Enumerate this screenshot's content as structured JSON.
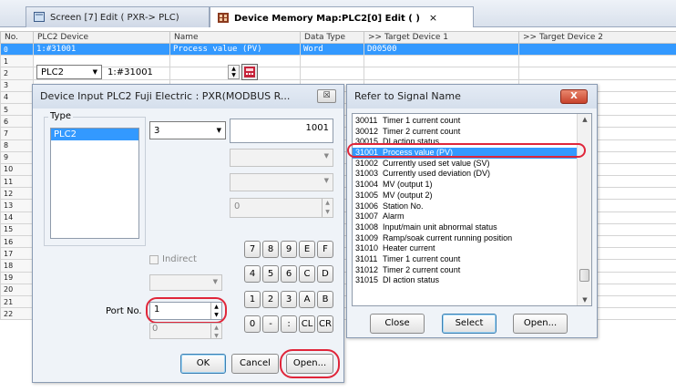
{
  "tabs": [
    {
      "label": "Screen [7] Edit (     PXR-> PLC)"
    },
    {
      "label": "Device Memory Map:PLC2[0] Edit (          )",
      "close": "×"
    }
  ],
  "sheet": {
    "columns": [
      "No.",
      "PLC2 Device",
      "Name",
      "Data Type",
      ">> Target Device 1",
      ">> Target Device 2"
    ],
    "row_numbers": [
      "0",
      "1",
      "2",
      "3",
      "4",
      "5",
      "6",
      "7",
      "8",
      "9",
      "10",
      "11",
      "12",
      "13",
      "14",
      "15",
      "16",
      "17",
      "18",
      "19",
      "20",
      "21",
      "22"
    ],
    "selected_row": {
      "device": "1:#31001",
      "name": "Process value (PV)",
      "type": "Word",
      "target1": "D00500"
    }
  },
  "edit_row": {
    "device_type": "PLC2",
    "address": "1:#31001"
  },
  "device_input": {
    "title": "Device Input  PLC2 Fuji Electric : PXR(MODBUS R...",
    "close": "☒",
    "type_label": "Type",
    "type_items": [
      "PLC2"
    ],
    "device_code": "3",
    "address_value": "1001",
    "station_value": "0",
    "indirect_label": "Indirect",
    "port_label": "Port No.",
    "port_value": "1",
    "port_sub_value": "0",
    "keys": [
      "7",
      "8",
      "9",
      "E",
      "F",
      "4",
      "5",
      "6",
      "C",
      "D",
      "1",
      "2",
      "3",
      "A",
      "B",
      "0",
      "-",
      ":",
      "CL",
      "CR"
    ],
    "ok": "OK",
    "cancel": "Cancel",
    "open": "Open..."
  },
  "signal_dialog": {
    "title": "Refer to Signal Name",
    "close": "X",
    "signals": [
      {
        "num": "30011",
        "name": "Timer 1 current count"
      },
      {
        "num": "30012",
        "name": "Timer 2 current count"
      },
      {
        "num": "30015",
        "name": "DI action status"
      },
      {
        "num": "31001",
        "name": "Process value (PV)"
      },
      {
        "num": "31002",
        "name": "Currently used set value (SV)"
      },
      {
        "num": "31003",
        "name": "Currently used deviation (DV)"
      },
      {
        "num": "31004",
        "name": "MV (output 1)"
      },
      {
        "num": "31005",
        "name": "MV (output 2)"
      },
      {
        "num": "31006",
        "name": "Station No."
      },
      {
        "num": "31007",
        "name": "Alarm"
      },
      {
        "num": "31008",
        "name": "Input/main unit abnormal status"
      },
      {
        "num": "31009",
        "name": "Ramp/soak current running position"
      },
      {
        "num": "31010",
        "name": "Heater current"
      },
      {
        "num": "31011",
        "name": "Timer 1 current count"
      },
      {
        "num": "31012",
        "name": "Timer 2 current count"
      },
      {
        "num": "31015",
        "name": "DI action status"
      }
    ],
    "close_btn": "Close",
    "select_btn": "Select",
    "open_btn": "Open..."
  }
}
